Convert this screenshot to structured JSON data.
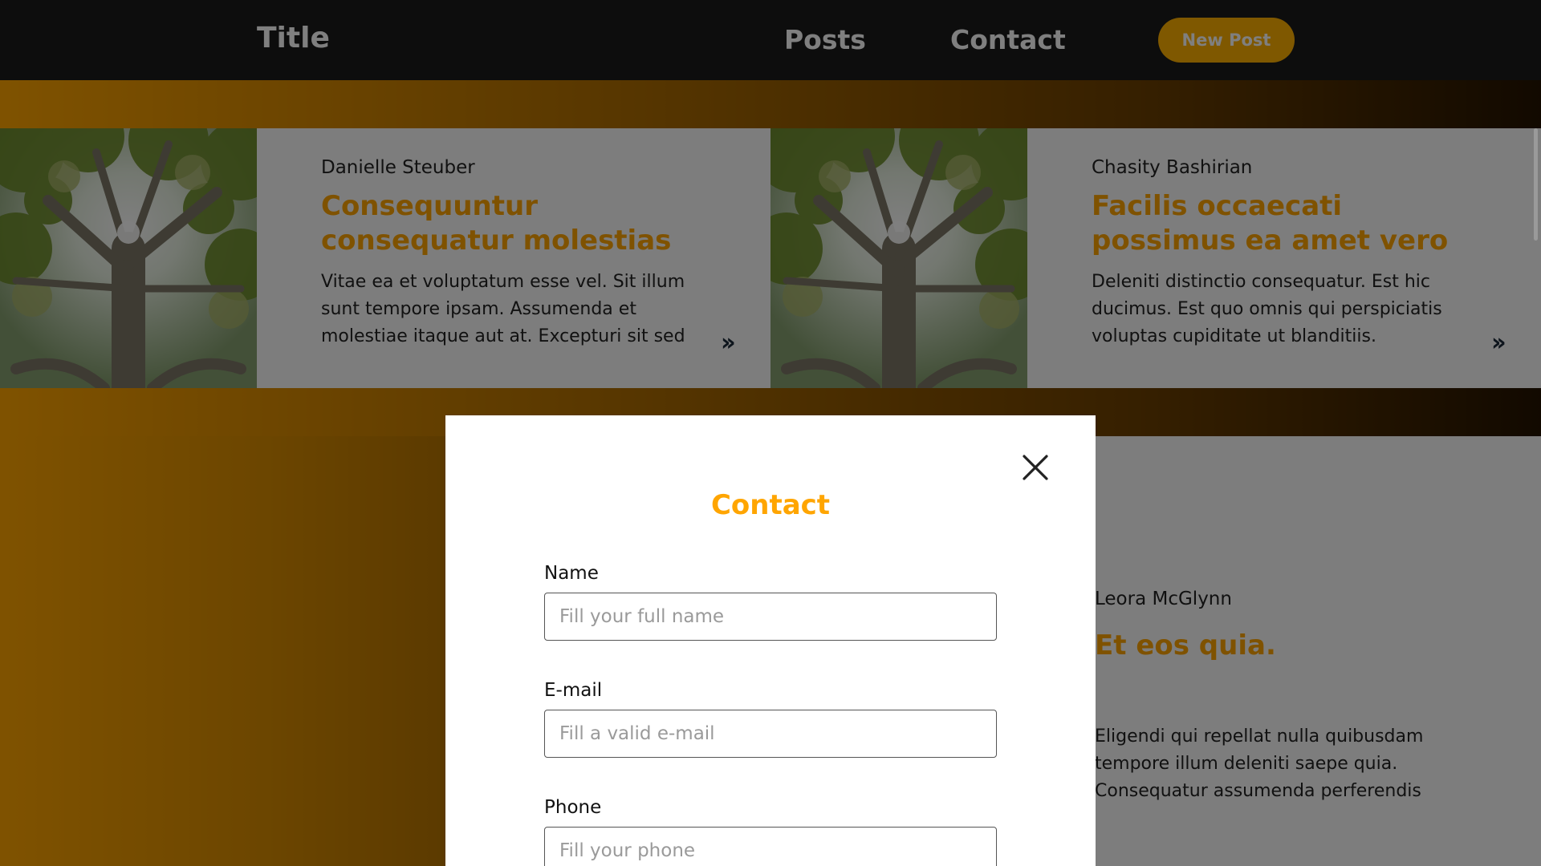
{
  "navbar": {
    "title": "Title",
    "links": [
      "Posts",
      "Contact"
    ],
    "new_post_label": "New Post"
  },
  "posts": [
    {
      "author": "Danielle Steuber",
      "title": "Consequuntur consequatur molestias",
      "excerpt": "Vitae ea et voluptatum esse vel. Sit illum sunt tempore ipsam. Assumenda et molestiae itaque aut at. Excepturi sit sed"
    },
    {
      "author": "Chasity Bashirian",
      "title": "Facilis occaecati possimus ea amet vero",
      "excerpt": "Deleniti distinctio consequatur. Est hic ducimus. Est quo omnis qui perspiciatis voluptas cupiditate ut blanditiis."
    },
    {
      "author": "Leora McGlynn",
      "title": "Et eos quia.",
      "excerpt": "Eligendi qui repellat nulla quibusdam tempore illum deleniti saepe quia. Consequatur assumenda perferendis"
    }
  ],
  "contact_modal": {
    "title": "Contact",
    "fields": [
      {
        "label": "Name",
        "placeholder": "Fill your full name"
      },
      {
        "label": "E-mail",
        "placeholder": "Fill a valid e-mail"
      },
      {
        "label": "Phone",
        "placeholder": "Fill your phone"
      }
    ]
  },
  "icons": {
    "close": "close-icon",
    "read_more": "double-chevron-right-icon",
    "thumbnail": "tree-image"
  },
  "colors": {
    "accent": "#ffa500",
    "navbar": "#1b1b1b",
    "card": "#fbfbfb",
    "overlay": "rgba(0,0,0,0.5)"
  }
}
